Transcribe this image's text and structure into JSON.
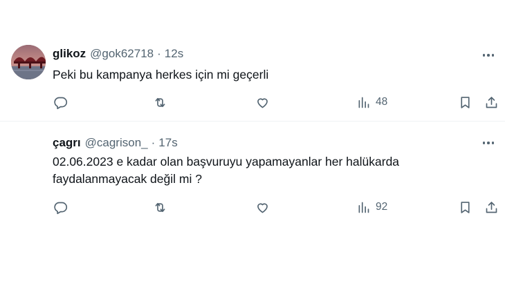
{
  "tweets": [
    {
      "display_name": "glikoz",
      "handle": "@gok62718",
      "separator": "·",
      "time": "12s",
      "text": "Peki bu kampanya herkes için mi geçerli",
      "view_count": "48",
      "has_avatar": true
    },
    {
      "display_name": "çagrı",
      "handle": "@cagrison_",
      "separator": "·",
      "time": "17s",
      "text_line1": "02.06.2023 e kadar olan başvuruyu yapamayanlar her halükarda",
      "text_line2": "faydalanmayacak değil mi ?",
      "view_count": "92",
      "has_avatar": false
    }
  ],
  "icons": {
    "more": "more-horizontal-icon",
    "reply": "reply-bubble-icon",
    "retweet": "retweet-icon",
    "like": "heart-icon",
    "views": "views-bar-chart-icon",
    "bookmark": "bookmark-icon",
    "share": "share-upload-icon"
  },
  "colors": {
    "text_primary": "#0f1419",
    "text_secondary": "#536471",
    "divider": "#eff3f4",
    "background": "#ffffff"
  }
}
